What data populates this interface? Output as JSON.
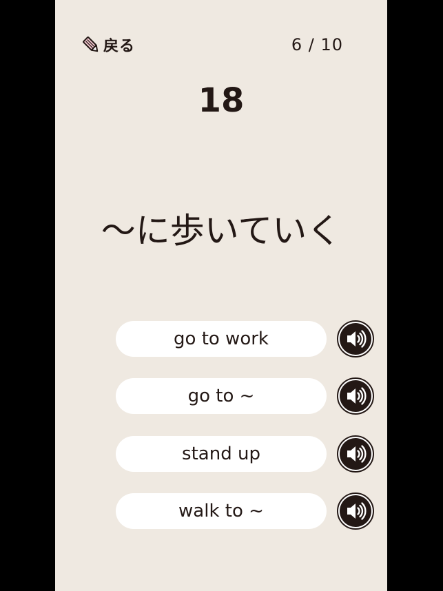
{
  "header": {
    "back_label": "戻る",
    "back_icon": "pencil-icon",
    "progress": "6 / 10"
  },
  "question": {
    "number": "18",
    "prompt": "〜に歩いていく"
  },
  "answers": [
    {
      "label": "go to work",
      "icon": "speaker-icon"
    },
    {
      "label": "go to ~",
      "icon": "speaker-icon"
    },
    {
      "label": "stand up",
      "icon": "speaker-icon"
    },
    {
      "label": "walk to ~",
      "icon": "speaker-icon"
    }
  ],
  "colors": {
    "background": "#efe9e1",
    "text": "#231815",
    "button": "#ffffff",
    "speaker": "#231815"
  }
}
